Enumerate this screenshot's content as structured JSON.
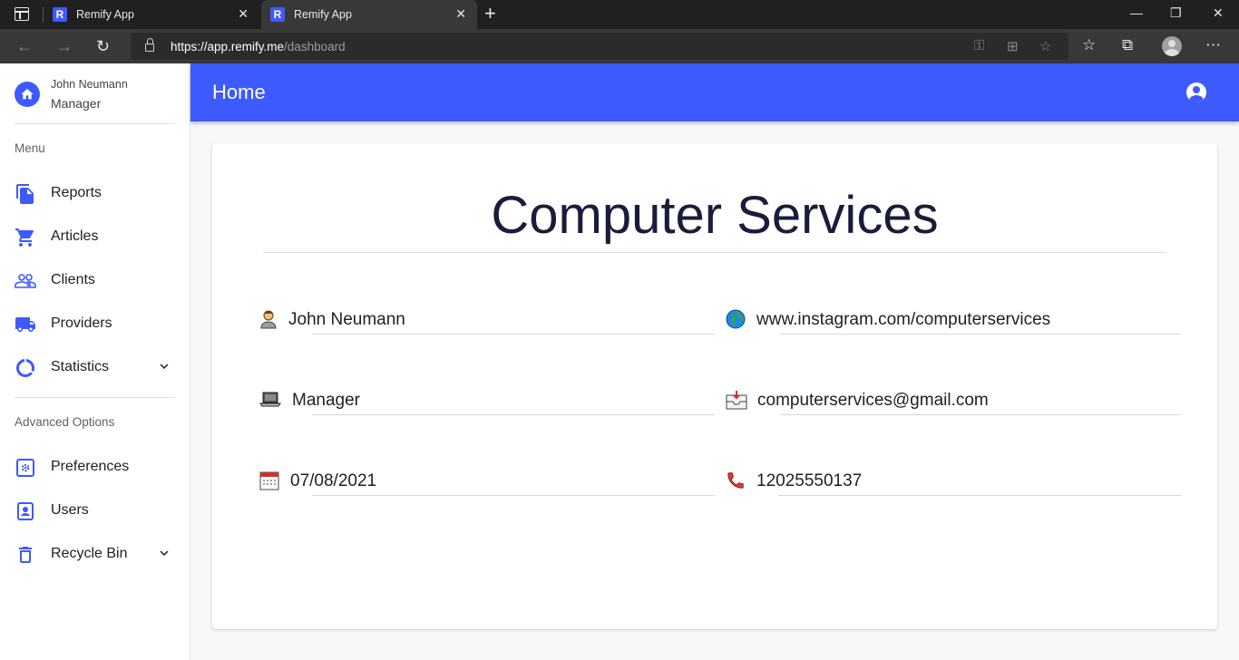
{
  "browser": {
    "tabs": [
      {
        "title": "Remify App",
        "favicon": "R"
      },
      {
        "title": "Remify App",
        "favicon": "R"
      }
    ],
    "url_host": "https://app.remify.me",
    "url_path": "/dashboard"
  },
  "sidebar": {
    "user_name": "John Neumann",
    "user_role": "Manager",
    "menu_label": "Menu",
    "menu_items": [
      {
        "label": "Reports",
        "icon": "file-copy-icon"
      },
      {
        "label": "Articles",
        "icon": "cart-icon"
      },
      {
        "label": "Clients",
        "icon": "people-icon"
      },
      {
        "label": "Providers",
        "icon": "truck-icon"
      },
      {
        "label": "Statistics",
        "icon": "donut-chart-icon",
        "expandable": true
      }
    ],
    "advanced_label": "Advanced Options",
    "advanced_items": [
      {
        "label": "Preferences",
        "icon": "settings-box-icon"
      },
      {
        "label": "Users",
        "icon": "user-box-icon"
      },
      {
        "label": "Recycle Bin",
        "icon": "trash-icon",
        "expandable": true
      }
    ]
  },
  "header": {
    "title": "Home"
  },
  "company": {
    "name": "Computer Services",
    "contact_name": "John Neumann",
    "role": "Manager",
    "date": "07/08/2021",
    "website": "www.instagram.com/computerservices",
    "email": "computerservices@gmail.com",
    "phone": "12025550137"
  },
  "colors": {
    "accent": "#3d5afe",
    "title_text": "#1a1d3a"
  }
}
